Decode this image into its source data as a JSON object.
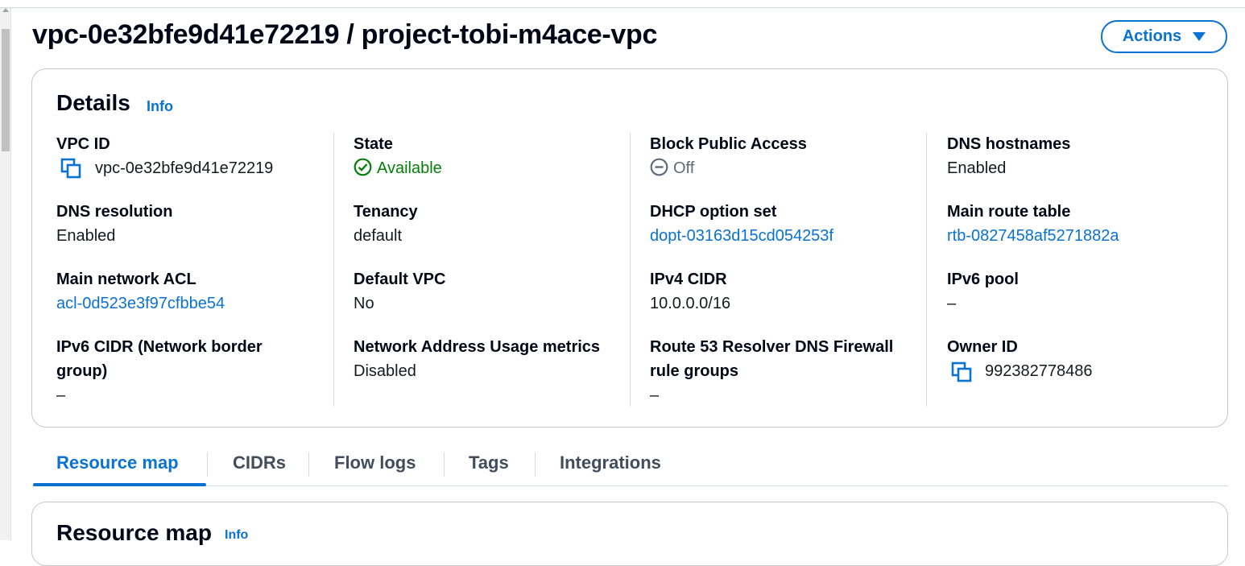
{
  "header": {
    "title": "vpc-0e32bfe9d41e72219 / project-tobi-m4ace-vpc",
    "actions_label": "Actions"
  },
  "details": {
    "heading": "Details",
    "info": "Info",
    "fields": {
      "vpc_id": {
        "label": "VPC ID",
        "value": "vpc-0e32bfe9d41e72219"
      },
      "state": {
        "label": "State",
        "value": "Available"
      },
      "block_public_access": {
        "label": "Block Public Access",
        "value": "Off"
      },
      "dns_hostnames": {
        "label": "DNS hostnames",
        "value": "Enabled"
      },
      "dns_resolution": {
        "label": "DNS resolution",
        "value": "Enabled"
      },
      "tenancy": {
        "label": "Tenancy",
        "value": "default"
      },
      "dhcp_option_set": {
        "label": "DHCP option set",
        "value": "dopt-03163d15cd054253f"
      },
      "main_route_table": {
        "label": "Main route table",
        "value": "rtb-0827458af5271882a"
      },
      "main_network_acl": {
        "label": "Main network ACL",
        "value": "acl-0d523e3f97cfbbe54"
      },
      "default_vpc": {
        "label": "Default VPC",
        "value": "No"
      },
      "ipv4_cidr": {
        "label": "IPv4 CIDR",
        "value": "10.0.0.0/16"
      },
      "ipv6_pool": {
        "label": "IPv6 pool",
        "value": "–"
      },
      "ipv6_cidr": {
        "label_line1": "IPv6 CIDR (Network border",
        "label_line2": "group)",
        "value": "–"
      },
      "network_address_usage": {
        "label": "Network Address Usage metrics",
        "value": "Disabled"
      },
      "route53_firewall": {
        "label_line1": "Route 53 Resolver DNS Firewall",
        "label_line2": "rule groups",
        "value": "–"
      },
      "owner_id": {
        "label": "Owner ID",
        "value": "992382778486"
      }
    }
  },
  "tabs": [
    {
      "label": "Resource map",
      "active": true
    },
    {
      "label": "CIDRs",
      "active": false
    },
    {
      "label": "Flow logs",
      "active": false
    },
    {
      "label": "Tags",
      "active": false
    },
    {
      "label": "Integrations",
      "active": false
    }
  ],
  "resource_map": {
    "heading": "Resource map",
    "info": "Info"
  },
  "colors": {
    "link": "#0972d3",
    "success": "#037f0c",
    "muted": "#5f6b7a"
  }
}
